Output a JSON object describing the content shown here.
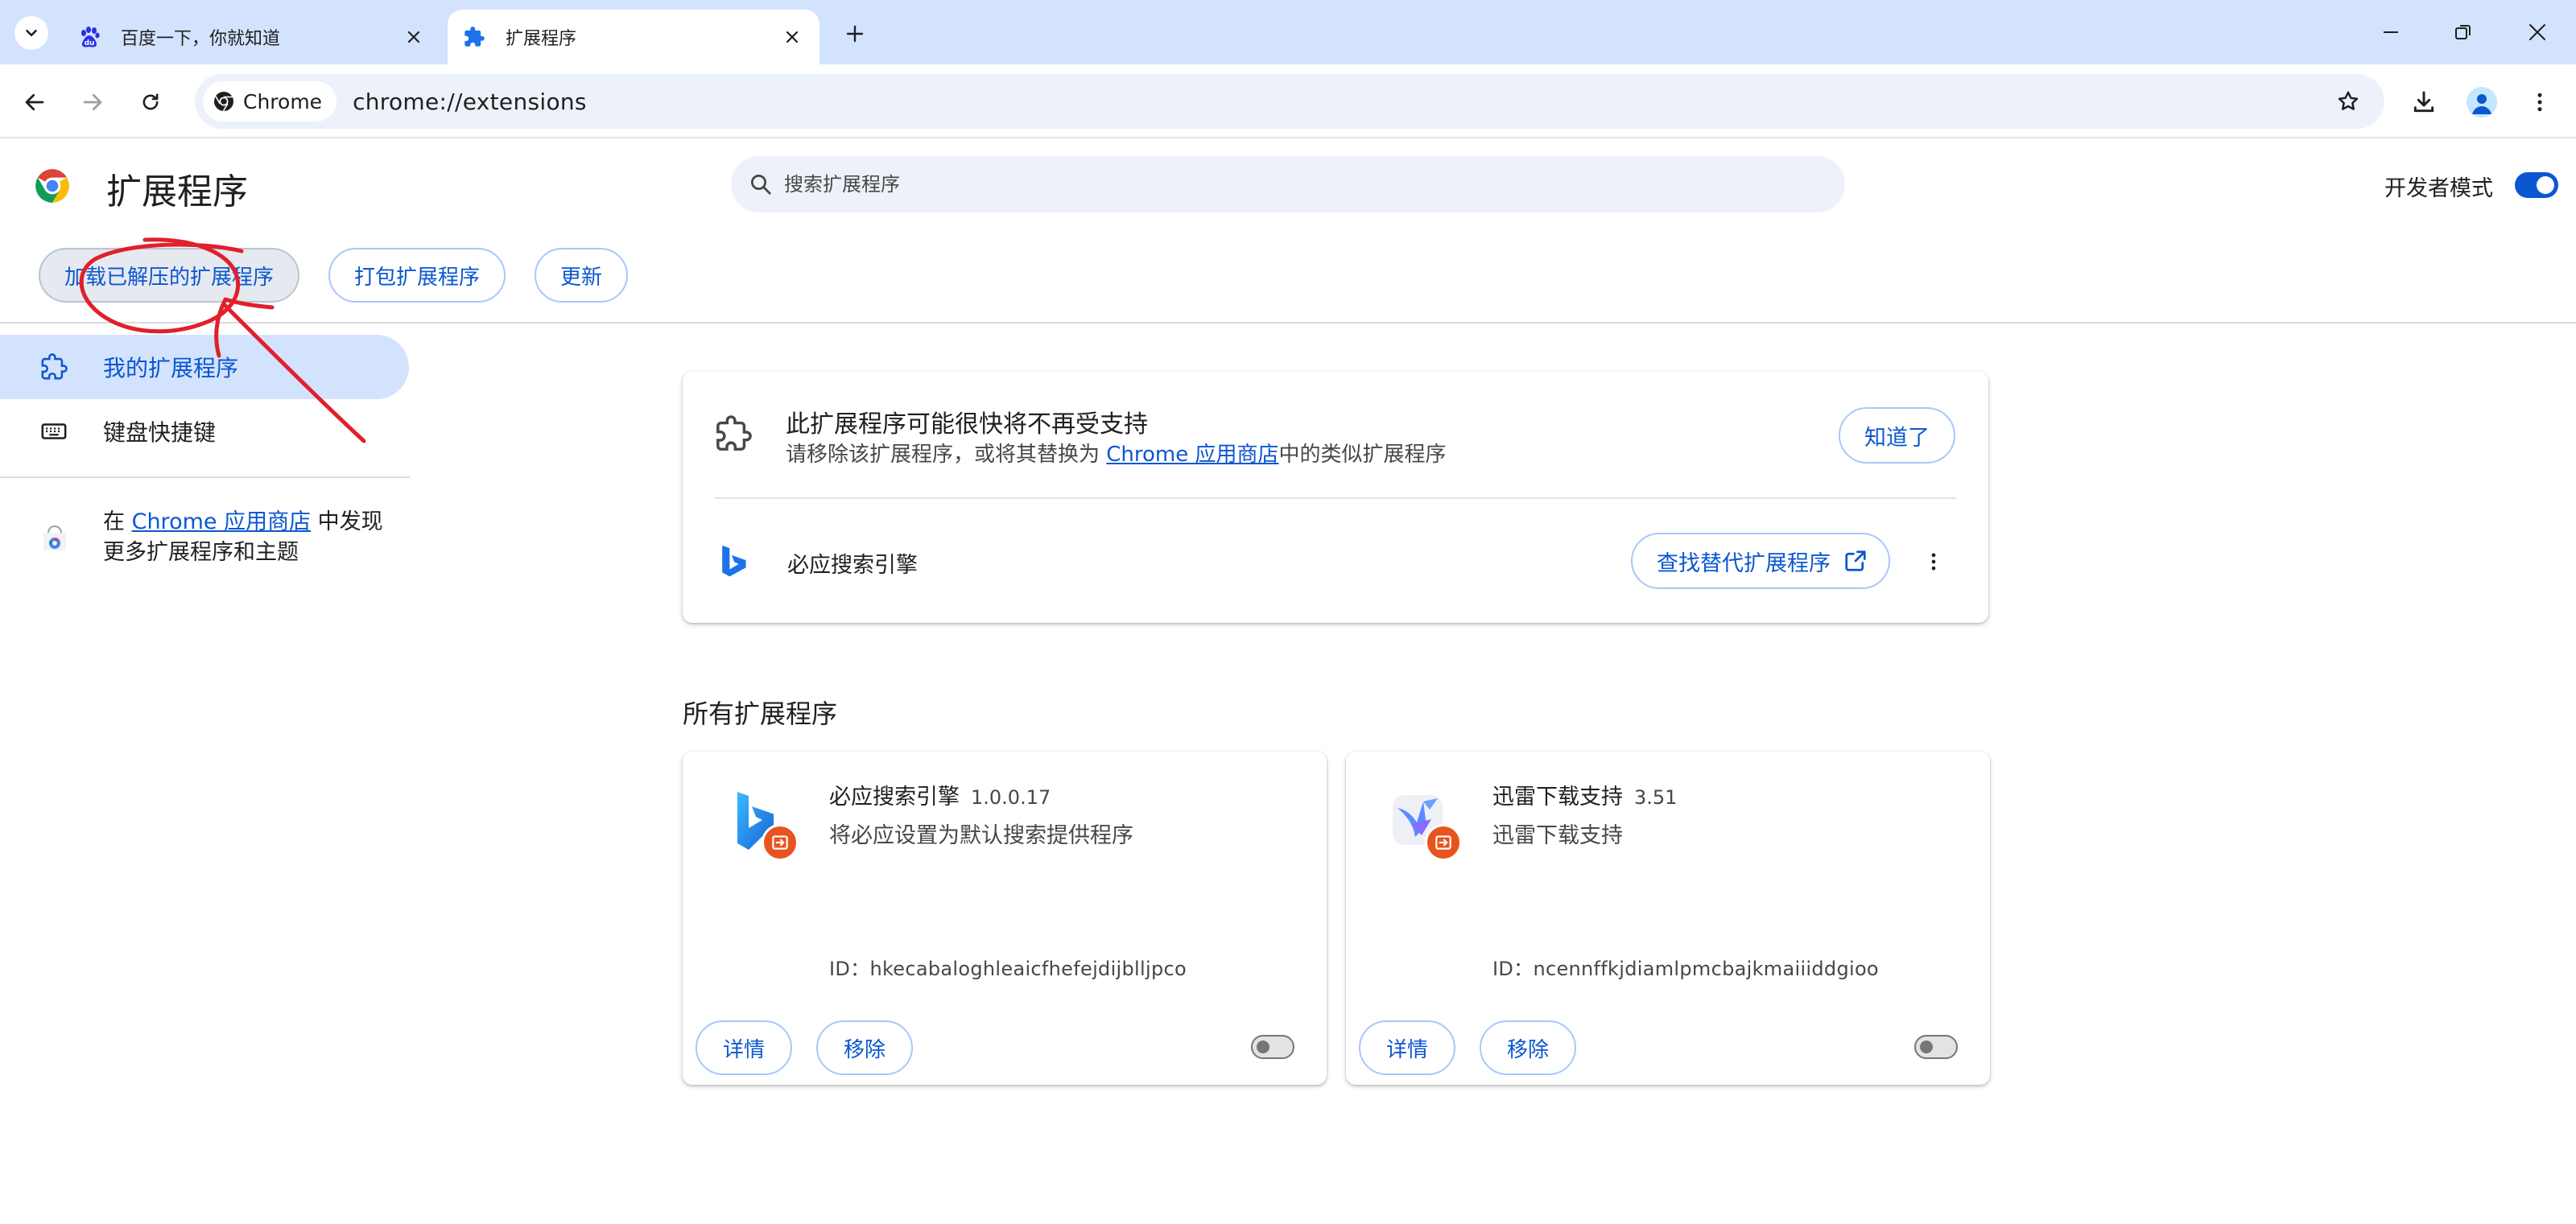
{
  "tabs": [
    {
      "title": "百度一下，你就知道",
      "active": false
    },
    {
      "title": "扩展程序",
      "active": true
    }
  ],
  "toolbar": {
    "site_chip": "Chrome",
    "url": "chrome://extensions"
  },
  "header": {
    "title": "扩展程序",
    "search_placeholder": "搜索扩展程序",
    "dev_mode_label": "开发者模式",
    "dev_mode_on": true,
    "buttons": {
      "load_unpacked": "加载已解压的扩展程序",
      "pack": "打包扩展程序",
      "update": "更新"
    }
  },
  "sidebar": {
    "items": [
      {
        "label": "我的扩展程序",
        "selected": true
      },
      {
        "label": "键盘快捷键",
        "selected": false
      }
    ],
    "discover": {
      "prefix": "在 ",
      "link": "Chrome 应用商店",
      "line1_suffix": " 中发现",
      "line2": "更多扩展程序和主题"
    }
  },
  "warning": {
    "title": "此扩展程序可能很快将不再受支持",
    "desc_prefix": "请移除该扩展程序，或将其替换为 ",
    "desc_link": "Chrome 应用商店",
    "desc_suffix": "中的类似扩展程序",
    "ok_button": "知道了",
    "extension_name": "必应搜索引擎",
    "find_alt_button": "查找替代扩展程序"
  },
  "all_extensions": {
    "title": "所有扩展程序",
    "details_label": "详情",
    "remove_label": "移除",
    "items": [
      {
        "name": "必应搜索引擎",
        "version": "1.0.0.17",
        "description": "将必应设置为默认搜索提供程序",
        "id": "ID：hkecabaloghleaicfhefejdijblljpco",
        "enabled": false
      },
      {
        "name": "迅雷下载支持",
        "version": "3.51",
        "description": "迅雷下载支持",
        "id": "ID：ncennffkjdiamlpmcbajkmaiiiddgioo",
        "enabled": false
      }
    ]
  },
  "colors": {
    "accent": "#0b57d0",
    "tabstrip": "#d3e3fd",
    "annotation": "#e0202a"
  },
  "icons": [
    "tab-search-icon",
    "baidu-paw-icon",
    "puzzle-icon",
    "close-icon",
    "plus-icon",
    "minimize-icon",
    "restore-icon",
    "back-icon",
    "forward-icon",
    "reload-icon",
    "chrome-icon",
    "star-icon",
    "download-icon",
    "profile-icon",
    "more-vert-icon",
    "search-icon",
    "keyboard-icon",
    "bing-icon",
    "open-in-new-icon",
    "xunlei-icon",
    "unpacked-badge-icon"
  ]
}
